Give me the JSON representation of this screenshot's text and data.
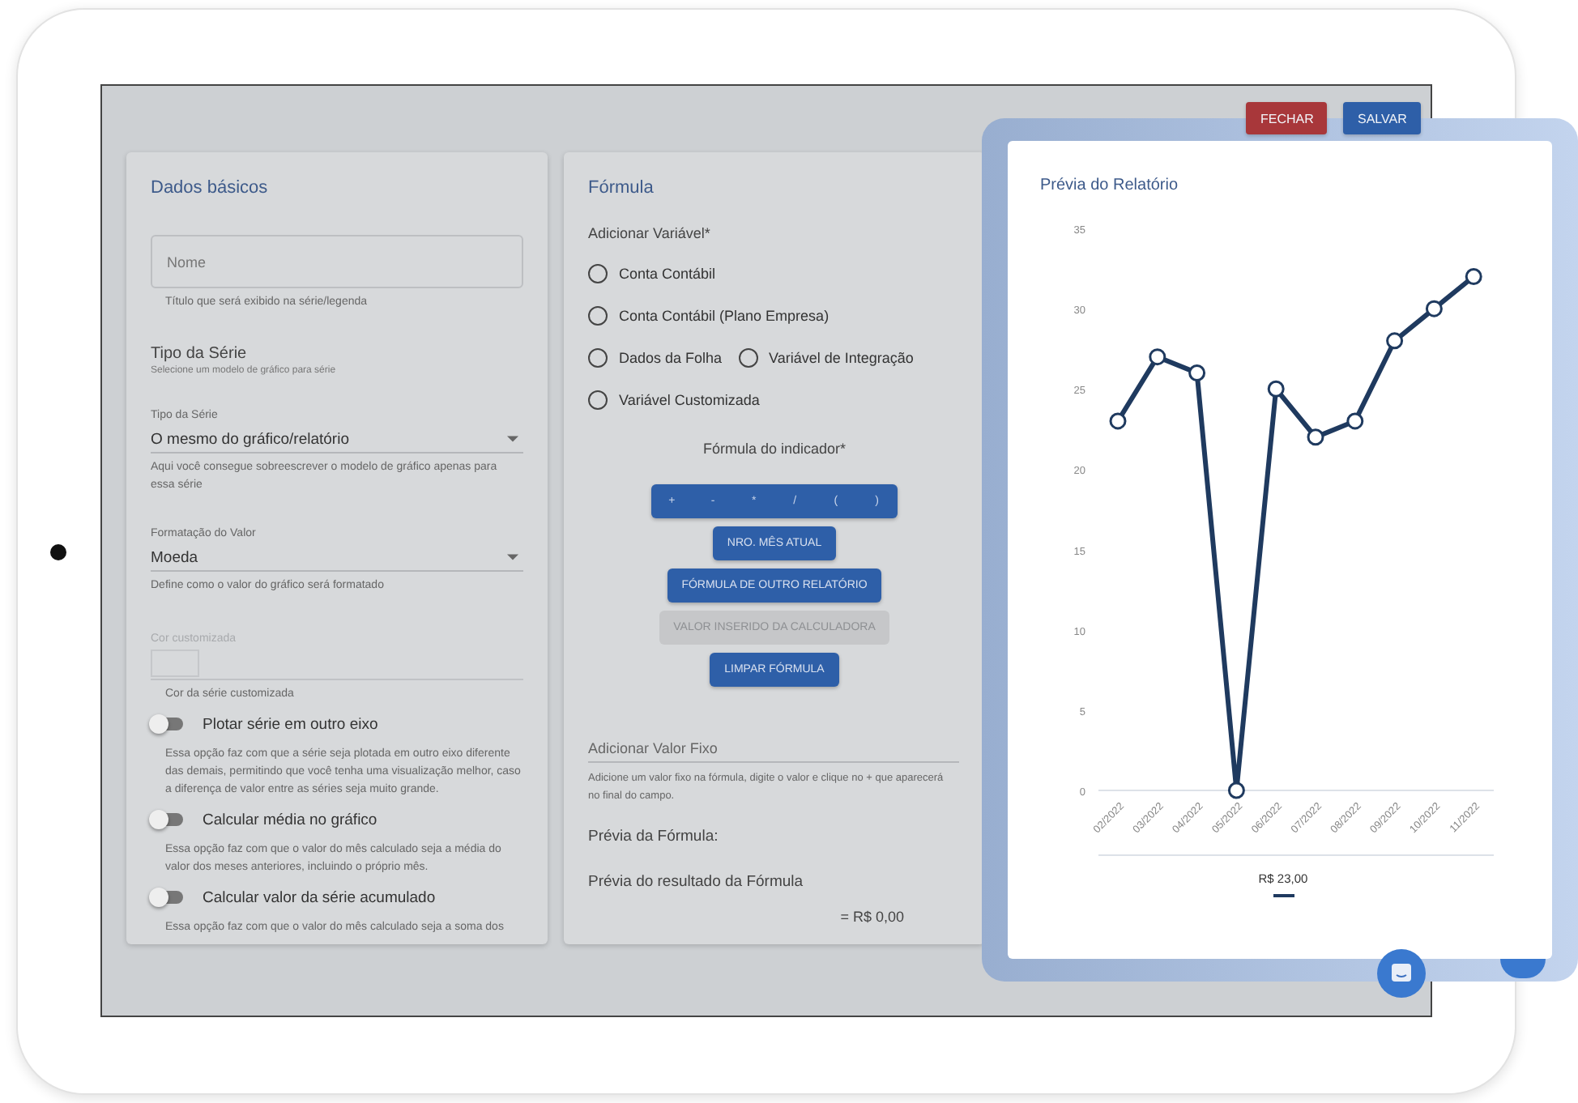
{
  "header_buttons": [
    {
      "label": "FECHAR",
      "kind": "danger"
    },
    {
      "label": "SALVAR",
      "kind": "primary"
    }
  ],
  "basic": {
    "title": "Dados básicos",
    "name_field": {
      "placeholder": "Nome",
      "hint": "Título que será exibido na série/legenda"
    },
    "series_type": {
      "heading": "Tipo da Série",
      "subheading": "Selecione um modelo de gráfico para série",
      "label": "Tipo da Série",
      "value": "O mesmo do gráfico/relatório",
      "hint": "Aqui você consegue sobreescrever o modelo de gráfico apenas para essa série"
    },
    "value_format": {
      "label": "Formatação do Valor",
      "value": "Moeda",
      "hint": "Define como o valor do gráfico será formatado"
    },
    "custom_color": {
      "label": "Cor customizada",
      "hint": "Cor da série customizada",
      "disabled": true
    },
    "toggles": [
      {
        "label": "Plotar série em outro eixo",
        "on": false,
        "description": "Essa opção faz com que a série seja plotada em outro eixo diferente das demais, permitindo que você tenha uma visualização melhor, caso a diferença de valor entre as séries seja muito grande."
      },
      {
        "label": "Calcular média no gráfico",
        "on": false,
        "description": "Essa opção faz com que o valor do mês calculado seja a média do valor dos meses anteriores, incluindo o próprio mês."
      },
      {
        "label": "Calcular valor da série acumulado",
        "on": false,
        "description": "Essa opção faz com que o valor do mês calculado seja a soma dos"
      }
    ]
  },
  "formula": {
    "title": "Fórmula",
    "variable_label": "Adicionar Variável*",
    "option_rows": [
      {
        "options": [
          {
            "label": "Conta Contábil",
            "selected": false
          }
        ]
      },
      {
        "options": [
          {
            "label": "Conta Contábil (Plano Empresa)",
            "selected": false
          }
        ]
      },
      {
        "options": [
          {
            "label": "Dados da Folha",
            "selected": false
          },
          {
            "label": "Variável de Integração",
            "selected": false
          }
        ]
      },
      {
        "options": [
          {
            "label": "Variável Customizada",
            "selected": false
          }
        ]
      }
    ],
    "formula_label": "Fórmula do indicador*",
    "operators": [
      "+",
      "-",
      "*",
      "/",
      "(",
      ")"
    ],
    "actions": [
      {
        "label": "NRO. MÊS ATUAL",
        "disabled": false
      },
      {
        "label": "FÓRMULA DE OUTRO RELATÓRIO",
        "disabled": false
      },
      {
        "label": "VALOR INSERIDO DA CALCULADORA",
        "disabled": true
      },
      {
        "label": "LIMPAR FÓRMULA",
        "disabled": false
      }
    ],
    "fixed_value": {
      "placeholder": "Adicionar Valor Fixo",
      "hint": "Adicione um valor fixo na fórmula, digite o valor e clique no + que aparecerá no final do campo."
    },
    "preview_label": "Prévia da Fórmula:",
    "result_label": "Prévia do resultado da Fórmula",
    "result": "= R$ 0,00"
  },
  "report_preview": {
    "title": "Prévia do Relatório",
    "chart_data": {
      "type": "line",
      "categories": [
        "02/2022",
        "03/2022",
        "04/2022",
        "05/2022",
        "06/2022",
        "07/2022",
        "08/2022",
        "09/2022",
        "10/2022",
        "11/2022"
      ],
      "series": [
        {
          "name": "R$ 23,00",
          "color": "#1f3a5f",
          "marker": "circle",
          "values": [
            23,
            27,
            26,
            0,
            25,
            22,
            23,
            28,
            30,
            32
          ]
        }
      ],
      "ylim": [
        0,
        35
      ],
      "yticks": [
        0,
        5,
        10,
        15,
        20,
        25,
        30,
        35
      ]
    }
  }
}
